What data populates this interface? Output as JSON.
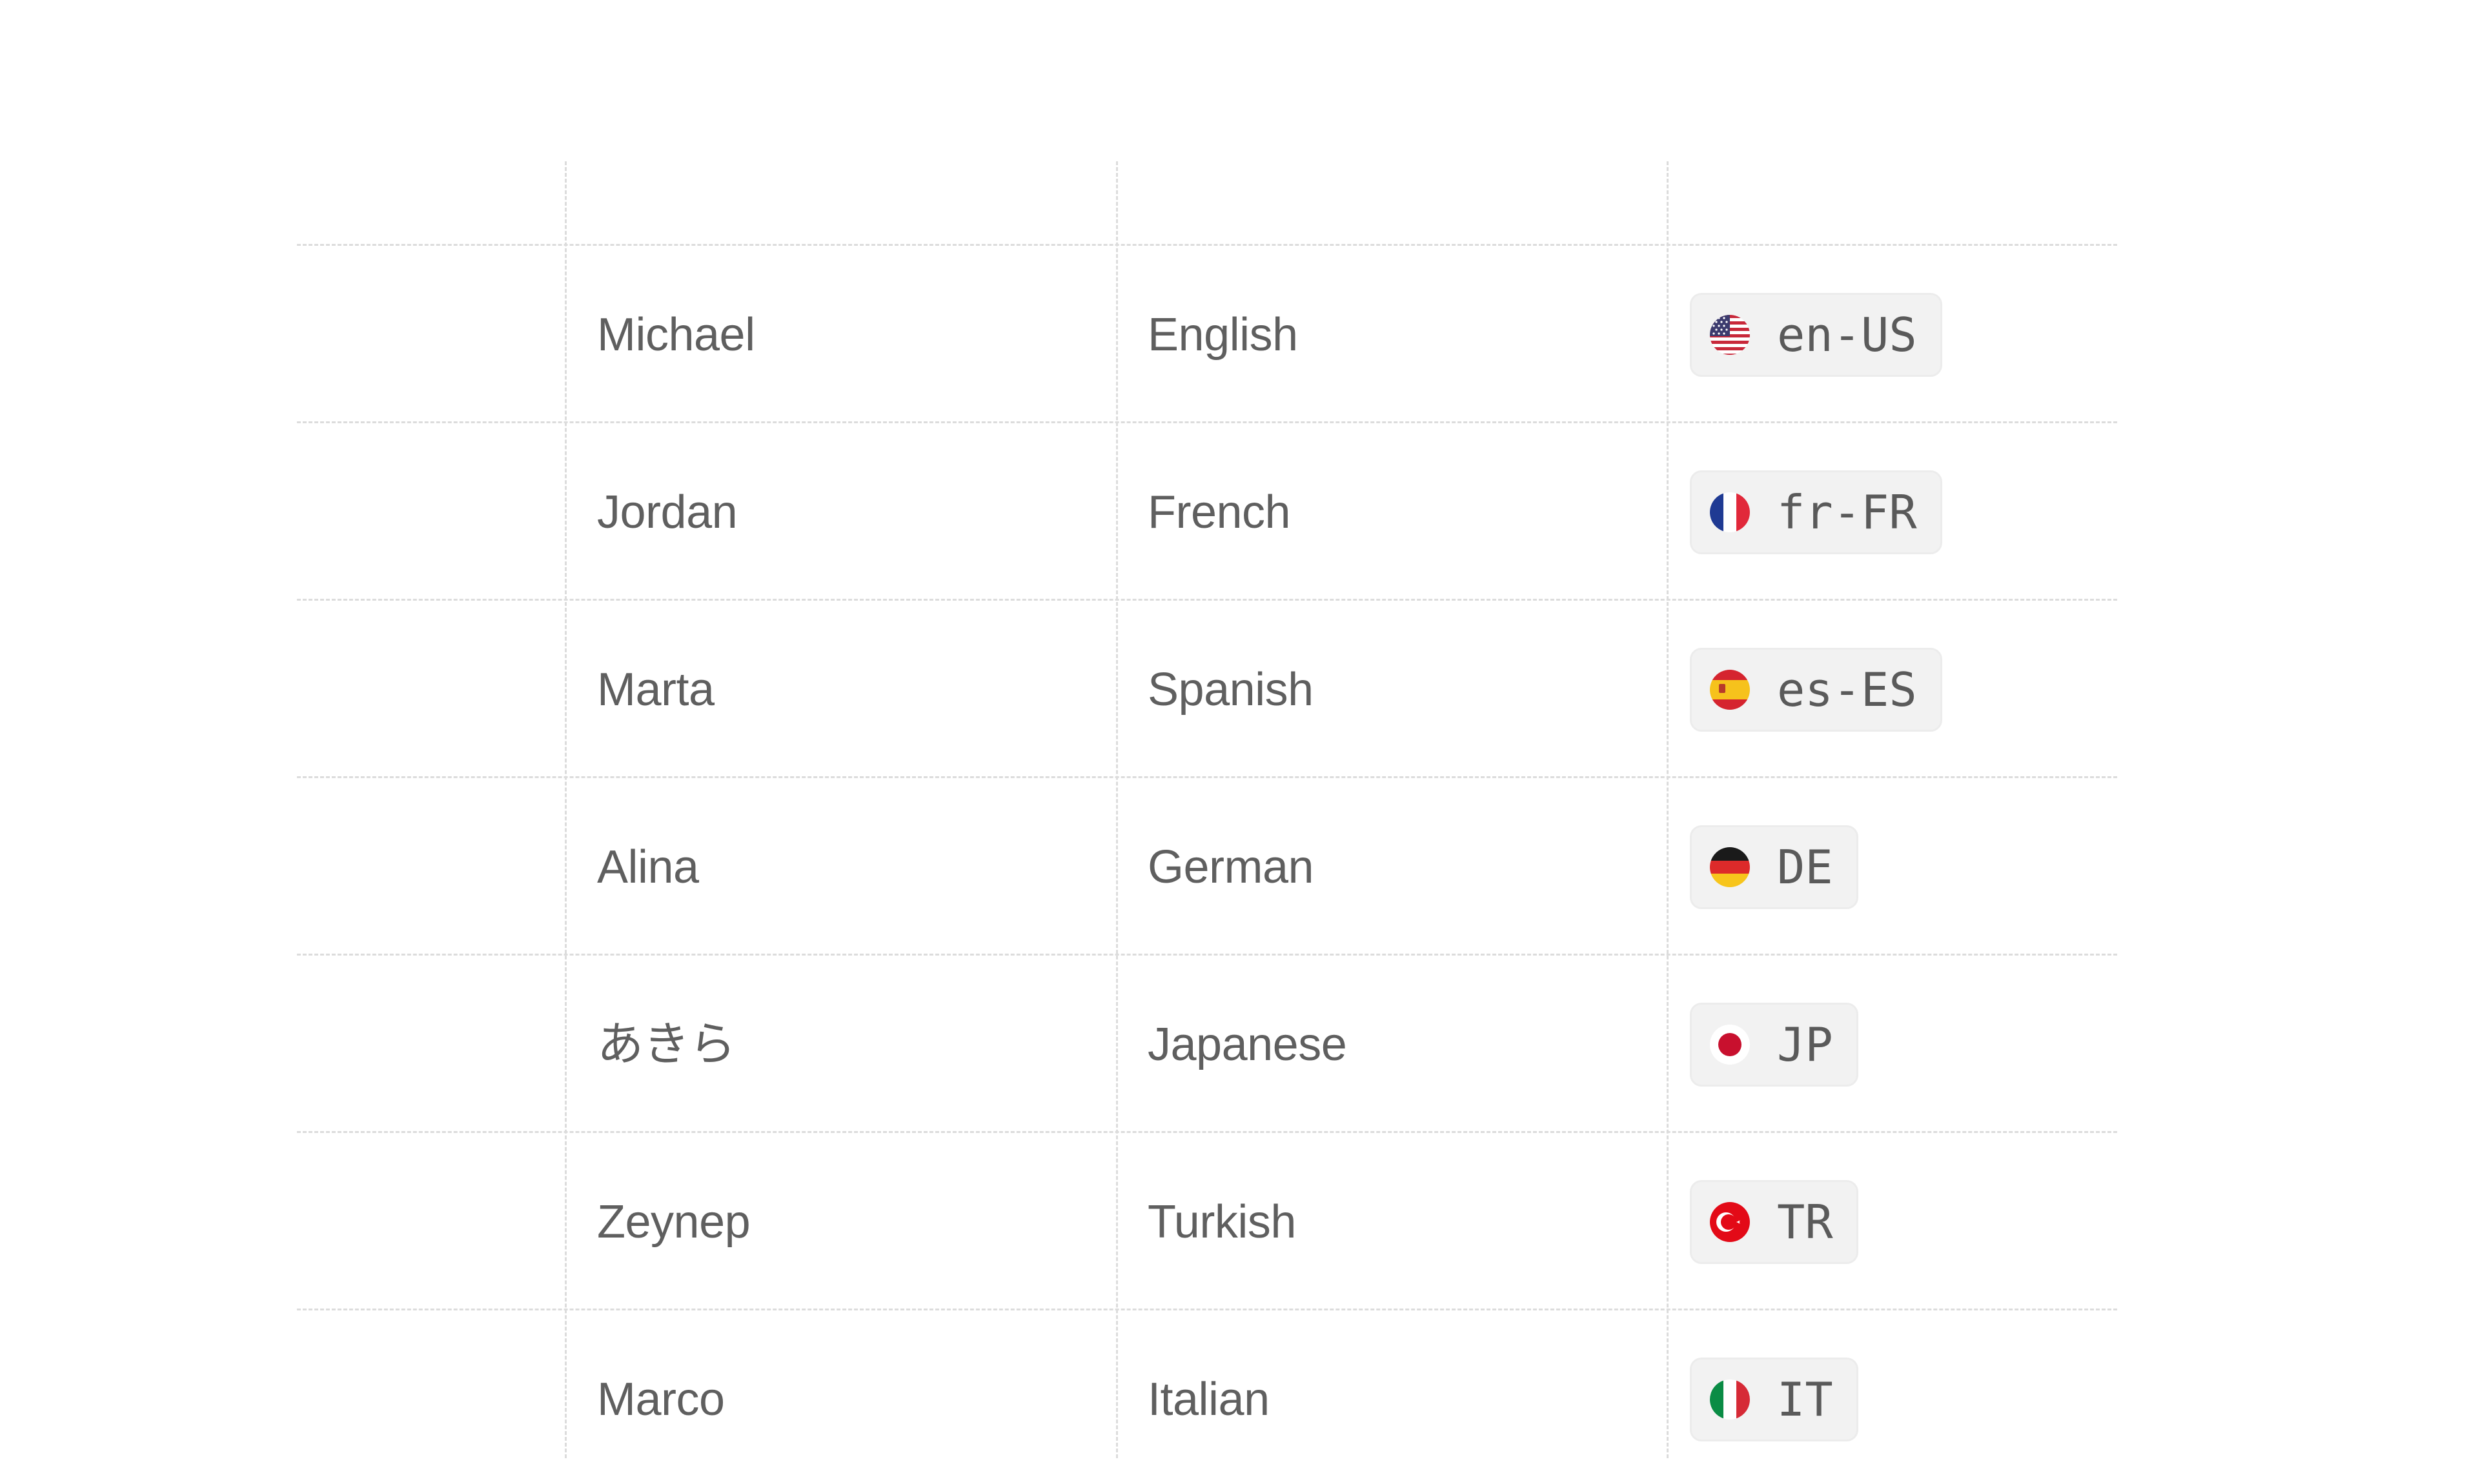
{
  "table": {
    "rows": [
      {
        "name": "Michael",
        "language": "English",
        "locale": "en-US",
        "flag_icon": "us-flag-icon"
      },
      {
        "name": "Jordan",
        "language": "French",
        "locale": "fr-FR",
        "flag_icon": "france-flag-icon"
      },
      {
        "name": "Marta",
        "language": "Spanish",
        "locale": "es-ES",
        "flag_icon": "spain-flag-icon"
      },
      {
        "name": "Alina",
        "language": "German",
        "locale": "DE",
        "flag_icon": "germany-flag-icon"
      },
      {
        "name": "あきら",
        "language": "Japanese",
        "locale": "JP",
        "flag_icon": "japan-flag-icon"
      },
      {
        "name": "Zeynep",
        "language": "Turkish",
        "locale": "TR",
        "flag_icon": "turkey-flag-icon"
      },
      {
        "name": "Marco",
        "language": "Italian",
        "locale": "IT",
        "flag_icon": "italy-flag-icon"
      }
    ]
  },
  "colors": {
    "text": "#5f5f5f",
    "grid": "#dcdcdc",
    "pill_bg": "#f2f2f2"
  }
}
